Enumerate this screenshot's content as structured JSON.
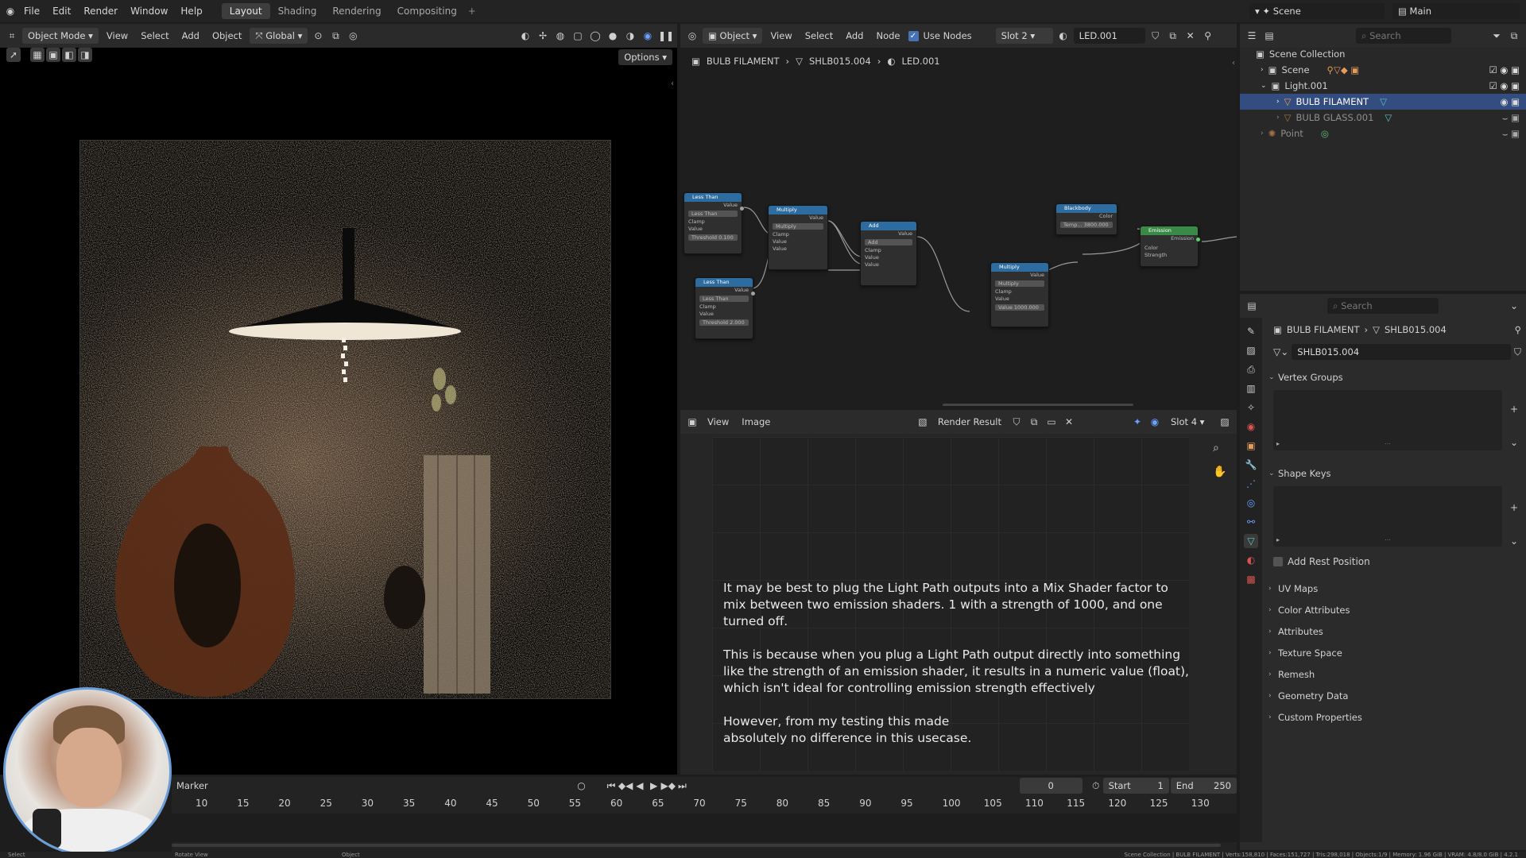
{
  "topbar": {
    "menus": [
      "File",
      "Edit",
      "Render",
      "Window",
      "Help"
    ],
    "workspaces": [
      "Layout",
      "Shading",
      "Rendering",
      "Compositing"
    ],
    "active_workspace": "Layout",
    "scene": "Scene",
    "view_layer": "Main"
  },
  "viewport": {
    "mode": "Object Mode",
    "menus": [
      "View",
      "Select",
      "Add",
      "Object"
    ],
    "transform": "Global",
    "options": "Options"
  },
  "node_editor": {
    "type": "Object",
    "menus": [
      "View",
      "Select",
      "Add",
      "Node"
    ],
    "use_nodes_label": "Use Nodes",
    "slot": "Slot 2",
    "material": "LED.001",
    "breadcrumb": [
      "BULB FILAMENT",
      "SHLB015.004",
      "LED.001"
    ],
    "nodes": {
      "less_than_1": {
        "title": "Less Than",
        "out": "Value",
        "op": "Less Than",
        "clamp": "Clamp",
        "in": "Value",
        "threshold": "Threshold  0.100"
      },
      "less_than_2": {
        "title": "Less Than",
        "out": "Value",
        "op": "Less Than",
        "clamp": "Clamp",
        "in": "Value",
        "threshold": "Threshold  2.000"
      },
      "multiply_1": {
        "title": "Multiply",
        "out": "Value",
        "op": "Multiply",
        "clamp": "Clamp",
        "in1": "Value",
        "in2": "Value"
      },
      "add": {
        "title": "Add",
        "out": "Value",
        "op": "Add",
        "clamp": "Clamp",
        "in1": "Value",
        "in2": "Value"
      },
      "multiply_2": {
        "title": "Multiply",
        "out": "Value",
        "op": "Multiply",
        "clamp": "Clamp",
        "in1": "Value",
        "val": "Value  1000.000"
      },
      "blackbody": {
        "title": "Blackbody",
        "out": "Color",
        "temp": "Temp...  3800.000"
      },
      "emission": {
        "title": "Emission",
        "out": "Emission",
        "in1": "Color",
        "in2": "Strength"
      }
    }
  },
  "image_editor": {
    "menus": [
      "View",
      "Image"
    ],
    "image": "Render Result",
    "slot": "Slot 4",
    "caption_p1": "It may be best to plug the Light Path outputs into a Mix Shader factor to mix between two emission shaders. 1 with a strength of 1000, and one turned off.",
    "caption_p2": "This is because when you plug a Light Path output directly into something like the strength of an emission shader, it results in a numeric value (float), which isn't ideal for controlling emission strength effectively",
    "caption_p3": "However, from my testing this made absolutely no difference in this usecase."
  },
  "outliner": {
    "search_placeholder": "Search",
    "root": "Scene Collection",
    "items": [
      {
        "label": "Scene",
        "indent": 1
      },
      {
        "label": "Light.001",
        "indent": 1
      },
      {
        "label": "BULB FILAMENT",
        "indent": 2,
        "selected": true
      },
      {
        "label": "BULB GLASS.001",
        "indent": 2
      },
      {
        "label": "Point",
        "indent": 1
      }
    ]
  },
  "properties": {
    "search_placeholder": "Search",
    "breadcrumb": [
      "BULB FILAMENT",
      "SHLB015.004"
    ],
    "mesh_name": "SHLB015.004",
    "sections_top": [
      "Vertex Groups",
      "Shape Keys"
    ],
    "add_rest": "Add Rest Position",
    "sections": [
      "UV Maps",
      "Color Attributes",
      "Attributes",
      "Texture Space",
      "Remesh",
      "Geometry Data",
      "Custom Properties"
    ]
  },
  "timeline": {
    "marker": "Marker",
    "current": "0",
    "start_label": "Start",
    "start": "1",
    "end_label": "End",
    "end": "250",
    "ticks": [
      "10",
      "15",
      "20",
      "25",
      "30",
      "35",
      "40",
      "45",
      "50",
      "55",
      "60",
      "65",
      "70",
      "75",
      "80",
      "85",
      "90",
      "95",
      "100",
      "105",
      "110",
      "115",
      "120",
      "125",
      "130"
    ]
  },
  "statusbar": {
    "left1": "Select",
    "left2": "Rotate View",
    "left3": "Object",
    "right": "Scene Collection | BULB FILAMENT | Verts:158,810 | Faces:151,727 | Tris:298,018 | Objects:1/9 | Memory: 1.96 GiB | VRAM: 4.8/8.0 GiB | 4.2.1"
  }
}
